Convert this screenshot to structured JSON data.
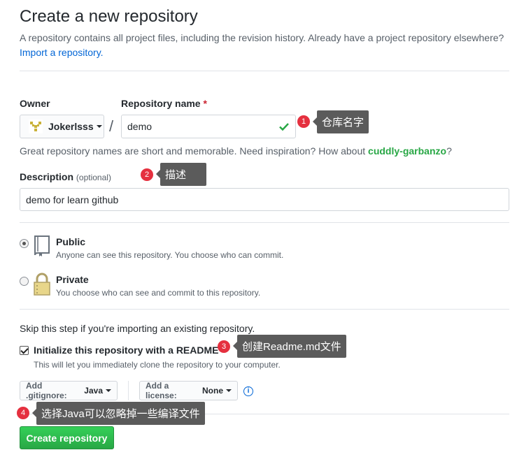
{
  "header": {
    "title": "Create a new repository",
    "intro_text": "A repository contains all project files, including the revision history. Already have a project repository elsewhere?",
    "import_link": "Import a repository."
  },
  "owner": {
    "label": "Owner",
    "name": "Jokerlsss"
  },
  "repo_name": {
    "label": "Repository name",
    "required_mark": "*",
    "value": "demo"
  },
  "hint": {
    "text": "Great repository names are short and memorable. Need inspiration? How about ",
    "suggestion": "cuddly-garbanzo",
    "end": "?"
  },
  "description": {
    "label": "Description",
    "optional": "(optional)",
    "value": "demo for learn github"
  },
  "visibility": {
    "selected": "public",
    "options": [
      {
        "title": "Public",
        "desc": "Anyone can see this repository. You choose who can commit."
      },
      {
        "title": "Private",
        "desc": "You choose who can see and commit to this repository."
      }
    ]
  },
  "init": {
    "skip_text": "Skip this step if you're importing an existing repository.",
    "readme_label": "Initialize this repository with a README",
    "readme_desc": "This will let you immediately clone the repository to your computer.",
    "readme_checked": true
  },
  "gitignore": {
    "label": "Add .gitignore:",
    "value": "Java"
  },
  "license": {
    "label": "Add a license:",
    "value": "None"
  },
  "info_icon": "i",
  "create_button": "Create repository",
  "annotations": [
    {
      "num": "1",
      "text": "仓库名字"
    },
    {
      "num": "2",
      "text": "描述"
    },
    {
      "num": "3",
      "text": "创建Readme.md文件"
    },
    {
      "num": "4",
      "text": "选择Java可以忽略掉一些编译文件"
    }
  ],
  "colors": {
    "accent": "#0366d6",
    "success": "#28a745",
    "annotation_badge": "#e5303f",
    "annotation_box": "#5b5b5b"
  }
}
